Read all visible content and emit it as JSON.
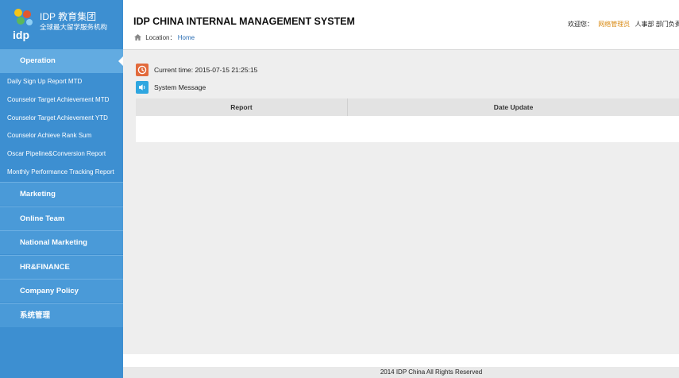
{
  "logo": {
    "brand": "IDP 教育集团",
    "subtitle": "全球最大留学服务机构",
    "mark_text": "idp",
    "colors": [
      "#f5c518",
      "#e4572e",
      "#3a9fd8",
      "#5cb85c"
    ]
  },
  "sidebar": {
    "active_section": "Operation",
    "active_items": [
      "Daily Sign Up Report MTD",
      "Counselor Target Achievement MTD",
      "Counselor Target Achievement YTD",
      "Counselor Achieve Rank Sum",
      "Oscar Pipeline&Conversion Report",
      "Monthly Performance Tracking Report"
    ],
    "sections": [
      "Marketing",
      "Online Team",
      "National Marketing",
      "HR&FINANCE",
      "Company Policy",
      "系统管理"
    ]
  },
  "header": {
    "title": "IDP CHINA INTERNAL MANAGEMENT SYSTEM",
    "location_label": "Location：",
    "location_link": "Home",
    "welcome": "欢迎您：",
    "user_name": "网络管理员",
    "user_roles": "人事部  部门负责人"
  },
  "main": {
    "current_time_label": "Current time: 2015-07-15 21:25:15",
    "system_message_label": "System Message",
    "table": {
      "columns": [
        "Report",
        "Date Update"
      ],
      "rows": []
    }
  },
  "footer": {
    "copyright": "2014 IDP China All Rights Reserved"
  },
  "theme": {
    "sidebar_bg": "#3d8fd1",
    "active_bg": "#62abe1",
    "link_color": "#2a6db4",
    "user_color": "#d98a13"
  }
}
